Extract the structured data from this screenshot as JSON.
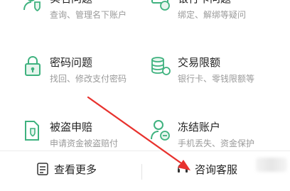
{
  "items": [
    {
      "title": "实名问题",
      "desc": "查询、管理名下账户",
      "icon": "user-shield-icon"
    },
    {
      "title": "银行卡问题",
      "desc": "绑定、解绑等疑问",
      "icon": "bank-card-icon"
    },
    {
      "title": "密码问题",
      "desc": "找回、修改支付密码",
      "icon": "lock-icon"
    },
    {
      "title": "交易限额",
      "desc": "银行卡、零钱限额等",
      "icon": "coin-stack-icon"
    },
    {
      "title": "被盗申赔",
      "desc": "申请资金被盗赔付",
      "icon": "document-shield-icon"
    },
    {
      "title": "冻结账户",
      "desc": "手机丢失、资金保护",
      "icon": "user-freeze-icon"
    }
  ],
  "bottom_bar": {
    "more_label": "查看更多",
    "service_label": "咨询客服"
  },
  "colors": {
    "accent": "#3fb27f",
    "annotation": "#e8322e"
  }
}
